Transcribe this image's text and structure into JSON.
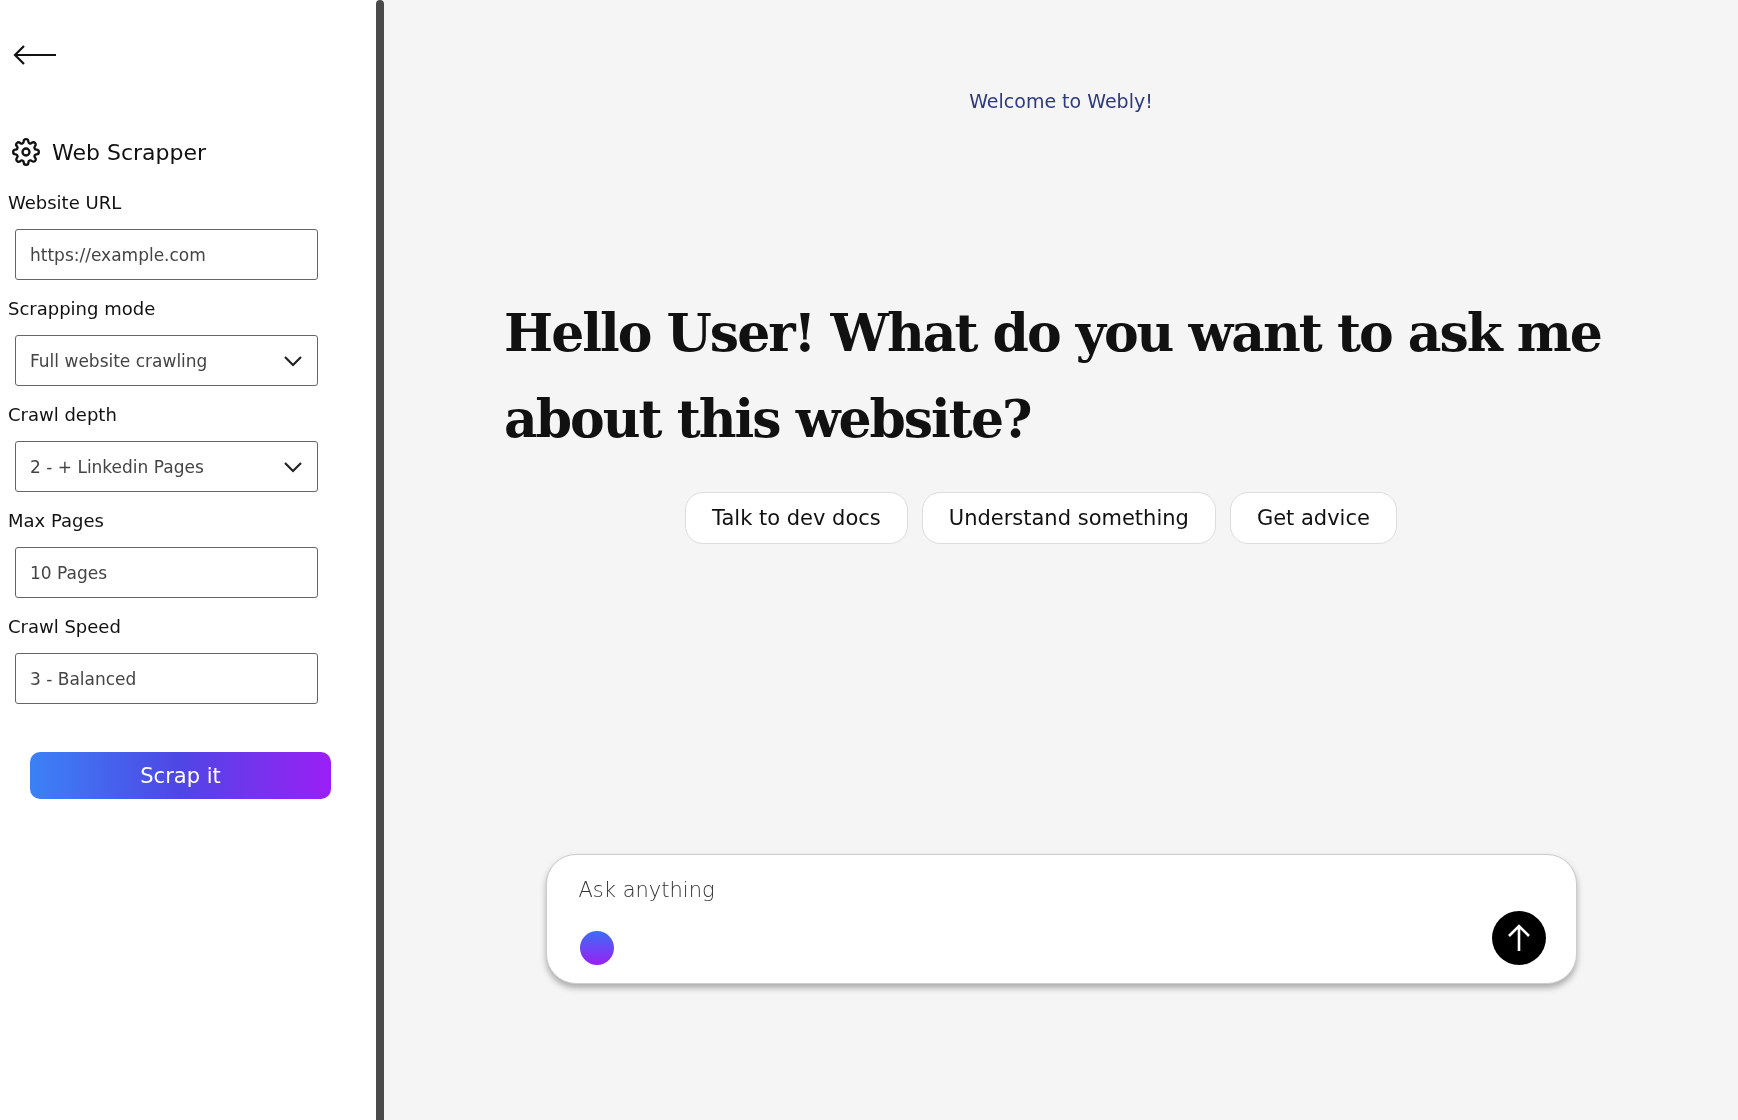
{
  "sidebar": {
    "title": "Web Scrapper",
    "fields": [
      {
        "kind": "input",
        "label": "Website URL",
        "placeholder": "https://example.com"
      },
      {
        "kind": "select",
        "label": "Scrapping mode",
        "value": "Full website crawling"
      },
      {
        "kind": "select",
        "label": "Crawl depth",
        "value": "2 - + Linkedin Pages"
      },
      {
        "kind": "input",
        "label": "Max Pages",
        "value": "10 Pages"
      },
      {
        "kind": "input",
        "label": "Crawl Speed",
        "value": "3 - Balanced"
      }
    ],
    "button": "Scrap it"
  },
  "main": {
    "welcome": "Welcome to Webly!",
    "heading": "Hello User!  What do you want to ask me about this website?",
    "suggestions": [
      "Talk to dev docs",
      "Understand something",
      "Get advice"
    ],
    "chat": {
      "placeholder": "Ask anything"
    }
  }
}
